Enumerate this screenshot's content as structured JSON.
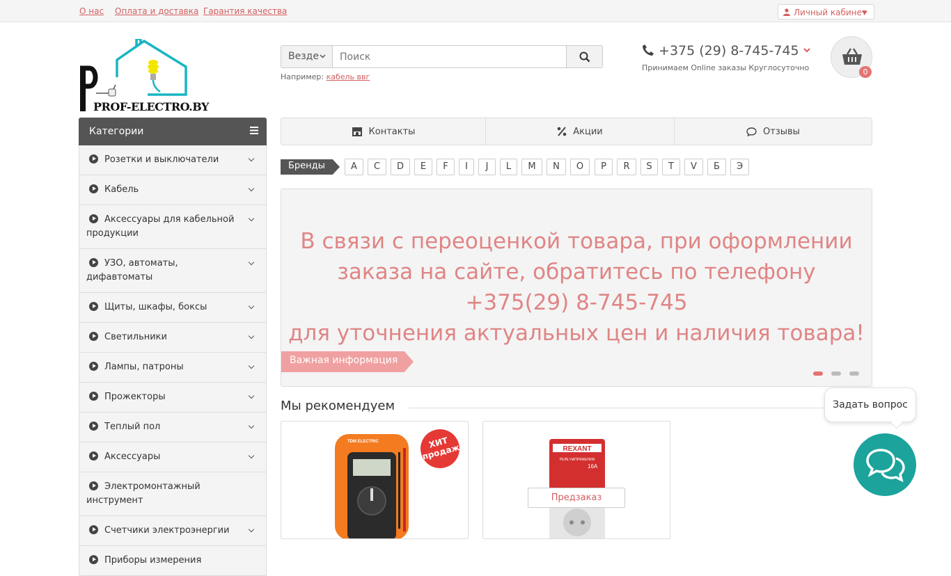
{
  "topbar": {
    "links": [
      "О нас",
      "Оплата и доставка",
      "Гарантия качества"
    ],
    "account_label": "Личный кабинет"
  },
  "logo": {
    "text": "PROF-ELECTRO.BY"
  },
  "search": {
    "scope": "Везде",
    "placeholder": "Поиск",
    "hint_prefix": "Например:",
    "hint_example": "кабель ввг"
  },
  "contact": {
    "phone": "+375 (29) 8-745-745",
    "note": "Принимаем Online заказы Круглосуточно"
  },
  "cart": {
    "count": "0"
  },
  "categories": {
    "title": "Категории",
    "items": [
      "Розетки и выключатели",
      "Кабель",
      "Аксессуары для кабельной продукции",
      "УЗО, автоматы, дифавтоматы",
      "Щиты, шкафы, боксы",
      "Светильники",
      "Лампы, патроны",
      "Прожекторы",
      "Теплый пол",
      "Аксессуары",
      "Электромонтажный инструмент",
      "Счетчики электроэнергии",
      "Приборы измерения"
    ]
  },
  "tabs": [
    "Контакты",
    "Акции",
    "Отзывы"
  ],
  "brands": {
    "label": "Бренды",
    "letters": [
      "A",
      "C",
      "D",
      "E",
      "F",
      "I",
      "J",
      "L",
      "M",
      "N",
      "O",
      "P",
      "R",
      "S",
      "T",
      "V",
      "Б",
      "Э"
    ]
  },
  "banner": {
    "lines": [
      "В связи с переоценкой товара, при оформлении",
      "заказа на сайте, обратитесь по телефону",
      "+375(29) 8-745-745",
      "для уточнения актуальных цен и наличия товара!"
    ],
    "tag": "Важная информация"
  },
  "recommend": {
    "title": "Мы рекомендуем",
    "hit_badge": "ХИТ продаж",
    "product1_brand": "TDM ELECTRIC",
    "product2_brand": "REXANT",
    "product2_label": "РЕЛЕ НАПРЯЖЕНИЯ",
    "product2_rating": "16A",
    "preorder": "Предзаказ"
  },
  "chat": {
    "ask": "Задать вопрос"
  },
  "colors": {
    "accent": "#d45f5f",
    "chat": "#1ba39c",
    "dark": "#555555"
  }
}
